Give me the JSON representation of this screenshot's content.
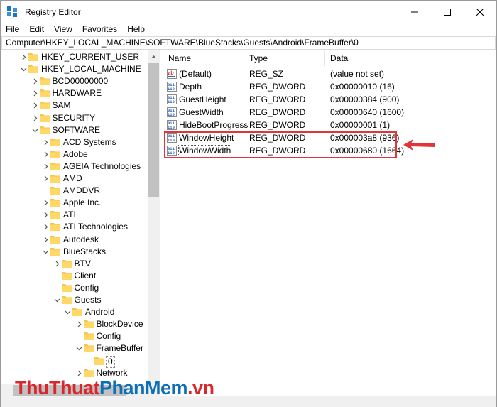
{
  "window": {
    "title": "Registry Editor",
    "controls": {
      "minimize_icon": "minimize-icon",
      "maximize_icon": "maximize-icon",
      "close_icon": "close-icon"
    }
  },
  "menu": [
    "File",
    "Edit",
    "View",
    "Favorites",
    "Help"
  ],
  "address": "Computer\\HKEY_LOCAL_MACHINE\\SOFTWARE\\BlueStacks\\Guests\\Android\\FrameBuffer\\0",
  "tree": [
    {
      "label": "HKEY_CURRENT_USER",
      "depth": 1,
      "expander": "right",
      "name": "hkey-current-user"
    },
    {
      "label": "HKEY_LOCAL_MACHINE",
      "depth": 1,
      "expander": "down",
      "name": "hkey-local-machine"
    },
    {
      "label": "BCD00000000",
      "depth": 2,
      "expander": "right",
      "name": "bcd00000000"
    },
    {
      "label": "HARDWARE",
      "depth": 2,
      "expander": "right",
      "name": "hardware"
    },
    {
      "label": "SAM",
      "depth": 2,
      "expander": "right",
      "name": "sam"
    },
    {
      "label": "SECURITY",
      "depth": 2,
      "expander": "right",
      "name": "security"
    },
    {
      "label": "SOFTWARE",
      "depth": 2,
      "expander": "down",
      "name": "software"
    },
    {
      "label": "ACD Systems",
      "depth": 3,
      "expander": "right",
      "name": "acd-systems"
    },
    {
      "label": "Adobe",
      "depth": 3,
      "expander": "right",
      "name": "adobe"
    },
    {
      "label": "AGEIA Technologies",
      "depth": 3,
      "expander": "right",
      "name": "ageia-technologies"
    },
    {
      "label": "AMD",
      "depth": 3,
      "expander": "right",
      "name": "amd"
    },
    {
      "label": "AMDDVR",
      "depth": 3,
      "expander": "none",
      "name": "amddvr"
    },
    {
      "label": "Apple Inc.",
      "depth": 3,
      "expander": "right",
      "name": "apple-inc"
    },
    {
      "label": "ATI",
      "depth": 3,
      "expander": "right",
      "name": "ati"
    },
    {
      "label": "ATI Technologies",
      "depth": 3,
      "expander": "right",
      "name": "ati-technologies"
    },
    {
      "label": "Autodesk",
      "depth": 3,
      "expander": "right",
      "name": "autodesk"
    },
    {
      "label": "BlueStacks",
      "depth": 3,
      "expander": "down",
      "name": "bluestacks"
    },
    {
      "label": "BTV",
      "depth": 4,
      "expander": "right",
      "name": "btv"
    },
    {
      "label": "Client",
      "depth": 4,
      "expander": "none",
      "name": "client"
    },
    {
      "label": "Config",
      "depth": 4,
      "expander": "none",
      "name": "config"
    },
    {
      "label": "Guests",
      "depth": 4,
      "expander": "down",
      "name": "guests"
    },
    {
      "label": "Android",
      "depth": 5,
      "expander": "down",
      "name": "android"
    },
    {
      "label": "BlockDevice",
      "depth": 6,
      "expander": "right",
      "name": "blockdevice"
    },
    {
      "label": "Config",
      "depth": 6,
      "expander": "none",
      "name": "android-config"
    },
    {
      "label": "FrameBuffer",
      "depth": 6,
      "expander": "down",
      "name": "framebuffer"
    },
    {
      "label": "0",
      "depth": 7,
      "expander": "none",
      "name": "framebuffer-0",
      "selected": true
    },
    {
      "label": "Network",
      "depth": 6,
      "expander": "right",
      "name": "network"
    }
  ],
  "list": {
    "columns": [
      "Name",
      "Type",
      "Data"
    ],
    "rows": [
      {
        "icon": "string-value-icon",
        "name": "(Default)",
        "type": "REG_SZ",
        "data": "(value not set)"
      },
      {
        "icon": "binary-value-icon",
        "name": "Depth",
        "type": "REG_DWORD",
        "data": "0x00000010 (16)"
      },
      {
        "icon": "binary-value-icon",
        "name": "GuestHeight",
        "type": "REG_DWORD",
        "data": "0x00000384 (900)"
      },
      {
        "icon": "binary-value-icon",
        "name": "GuestWidth",
        "type": "REG_DWORD",
        "data": "0x00000640 (1600)"
      },
      {
        "icon": "binary-value-icon",
        "name": "HideBootProgress",
        "type": "REG_DWORD",
        "data": "0x00000001 (1)"
      },
      {
        "icon": "binary-value-icon",
        "name": "WindowHeight",
        "type": "REG_DWORD",
        "data": "0x000003a8 (936)",
        "highlighted": true
      },
      {
        "icon": "binary-value-icon",
        "name": "WindowWidth",
        "type": "REG_DWORD",
        "data": "0x00000680 (1664)",
        "highlighted": true,
        "focused": true
      }
    ]
  },
  "annotation": {
    "highlight_color": "#e2353b",
    "arrow_icon": "arrow-left-icon"
  },
  "watermark": {
    "part1": "ThuThuat",
    "part2": "PhanMem",
    "part3": ".vn",
    "color_red": "#d8272d",
    "color_blue": "#0f6fb5"
  }
}
